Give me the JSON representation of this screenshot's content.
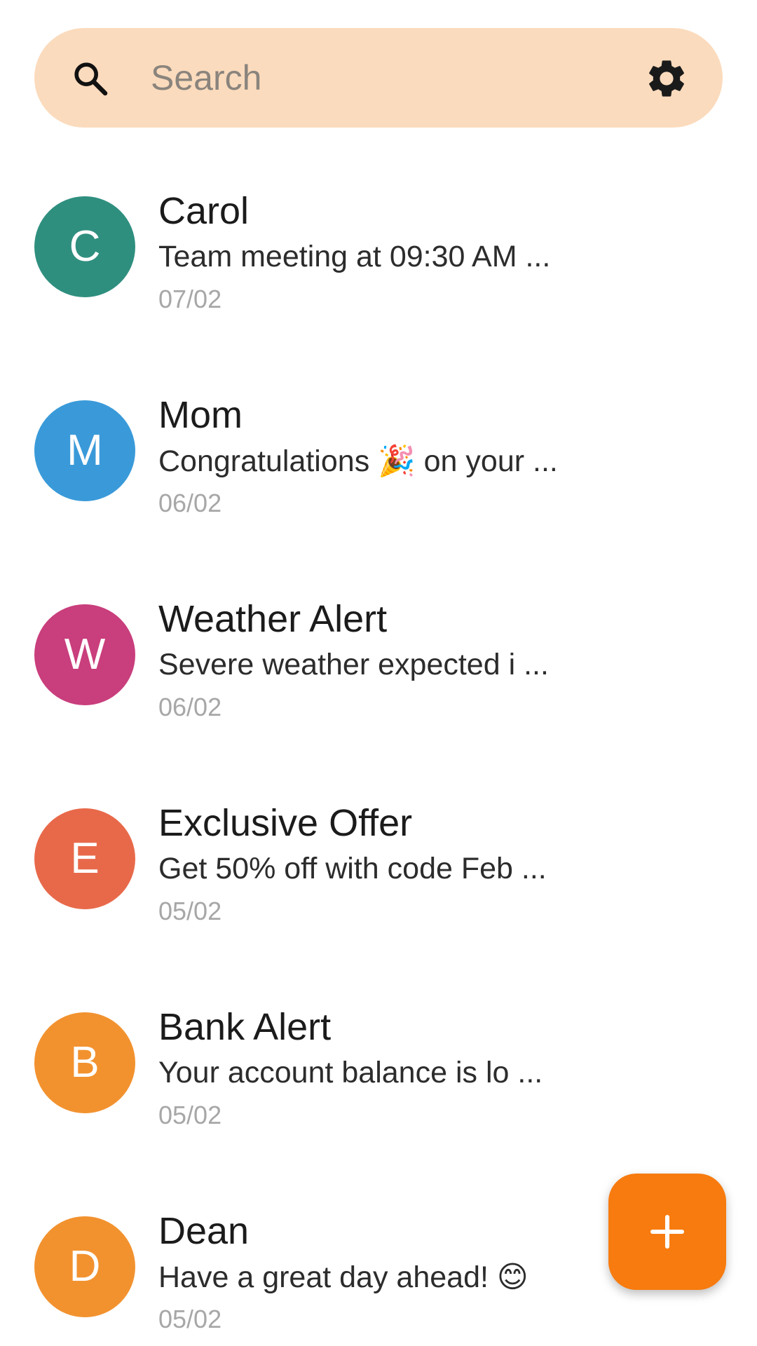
{
  "search": {
    "placeholder": "Search",
    "value": ""
  },
  "colors": {
    "search_bg": "#fbdbbd",
    "fab_bg": "#f77b0e",
    "date_text": "#a7a7a7"
  },
  "conversations": [
    {
      "initial": "C",
      "name": "Carol",
      "preview": "Team meeting at 09:30 AM ...",
      "date": "07/02",
      "color": "#2f8f7f"
    },
    {
      "initial": "M",
      "name": "Mom",
      "preview": "Congratulations 🎉 on your ...",
      "date": "06/02",
      "color": "#3a9ad9"
    },
    {
      "initial": "W",
      "name": "Weather Alert",
      "preview": "Severe weather expected i ...",
      "date": "06/02",
      "color": "#c93e7c"
    },
    {
      "initial": "E",
      "name": "Exclusive Offer",
      "preview": "Get 50% off with code Feb ...",
      "date": "05/02",
      "color": "#e8694a"
    },
    {
      "initial": "B",
      "name": "Bank Alert",
      "preview": "Your account balance is lo ...",
      "date": "05/02",
      "color": "#f2922f"
    },
    {
      "initial": "D",
      "name": "Dean",
      "preview": "Have a great day ahead! 😊",
      "date": "05/02",
      "color": "#f2922f"
    }
  ],
  "icons": {
    "search": "search-icon",
    "settings": "gear-icon",
    "new_message": "plus-icon"
  }
}
